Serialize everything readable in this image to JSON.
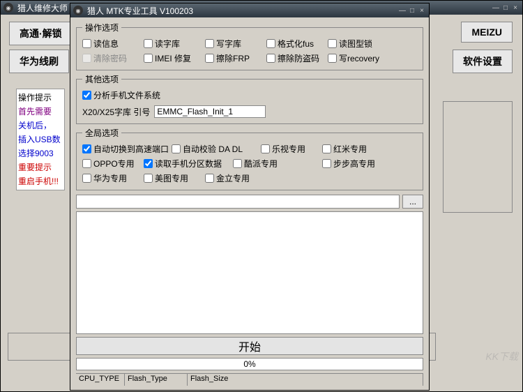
{
  "main_window": {
    "title": "猎人维修大师 V",
    "buttons": {
      "qualcomm": "高通·解锁",
      "huawei_flash": "华为线刷",
      "meizu": "MEIZU",
      "software_settings": "软件设置"
    },
    "tips": {
      "header": "操作提示",
      "line1": "首先需要",
      "line2": "关机后，",
      "line3": "插入USB数",
      "line4": "选择9003",
      "line5": "重要提示",
      "line6": "重启手机!!!"
    },
    "watermark": "KK下载"
  },
  "tool_window": {
    "title": "猎人 MTK专业工具 V100203",
    "groups": {
      "operation": {
        "legend": "操作选项",
        "items": {
          "read_info": "读信息",
          "read_font": "读字库",
          "write_font": "写字库",
          "format": "格式化fus",
          "read_pattern_lock": "读图型锁",
          "clear_password": "清除密码",
          "imei_repair": "IMEI 修复",
          "erase_frp": "擦除FRP",
          "erase_antitheft": "擦除防盗码",
          "write_recovery": "写recovery"
        }
      },
      "other": {
        "legend": "其他选项",
        "analyze_fs": "分析手机文件系统",
        "font_index_label": "X20/X25字库 引号",
        "font_index_value": "EMMC_Flash_Init_1"
      },
      "global": {
        "legend": "全局选项",
        "items": {
          "auto_highspeed": "自动切换到高速端口",
          "auto_verify_dadl": "自动校验 DA DL",
          "letv": "乐视专用",
          "hongmi": "红米专用",
          "oppo": "OPPO专用",
          "read_partition": "读取手机分区数据",
          "coolpad": "酷派专用",
          "bbk": "步步高专用",
          "huawei": "华为专用",
          "meitu": "美图专用",
          "gionee": "金立专用"
        }
      }
    },
    "path_value": "",
    "browse_btn": "...",
    "start_btn": "开始",
    "progress": "0%",
    "status": {
      "cpu": "CPU_TYPE",
      "flash_type": "Flash_Type",
      "flash_size": "Flash_Size"
    }
  }
}
